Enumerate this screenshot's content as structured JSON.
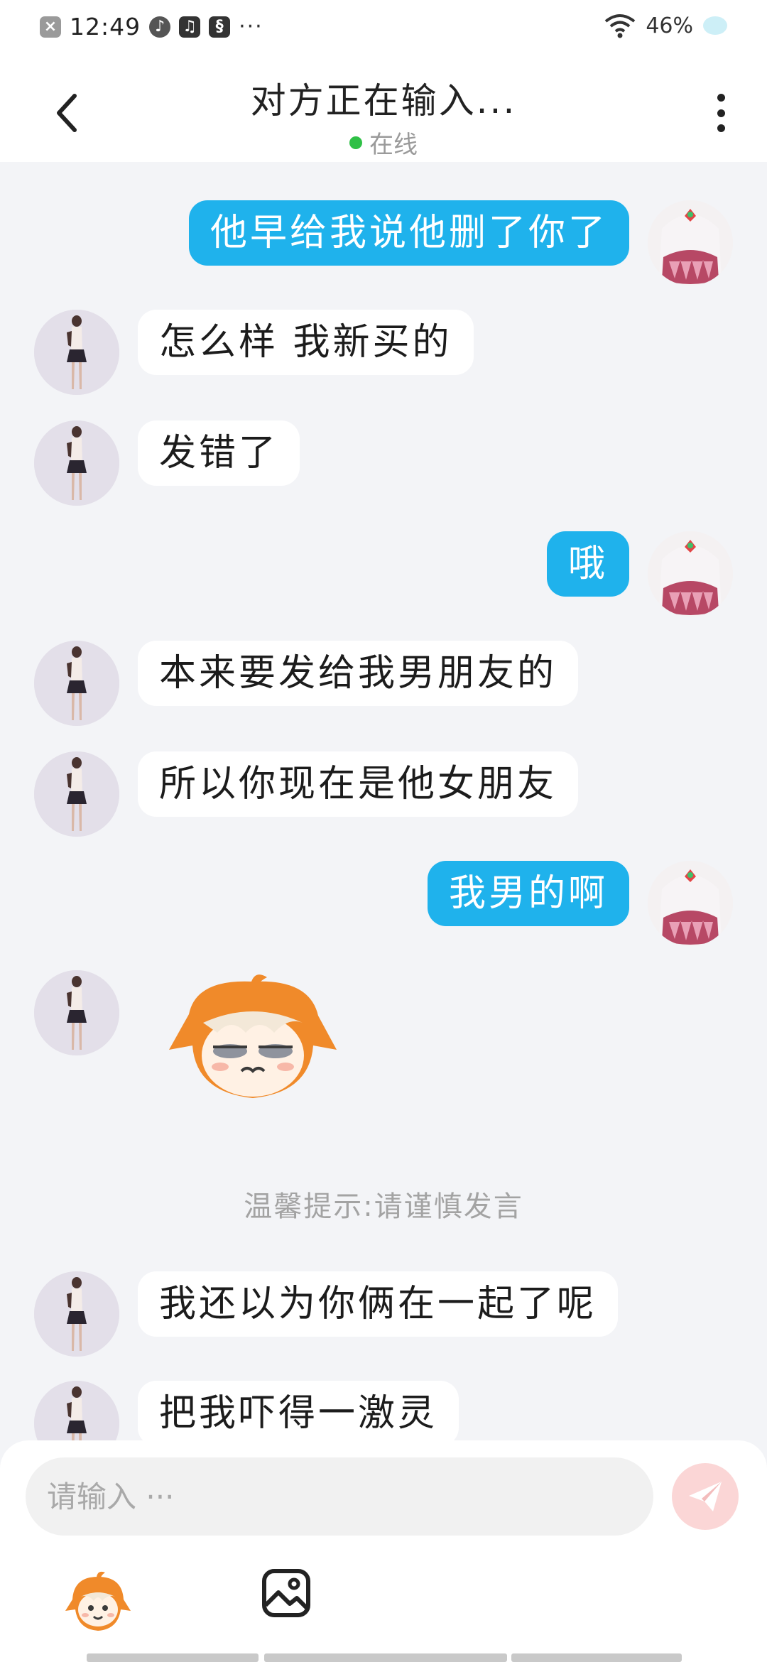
{
  "status_bar": {
    "time": "12:49",
    "more": "···",
    "battery": "46%"
  },
  "header": {
    "title": "对方正在输入...",
    "status": "在线"
  },
  "messages": [
    {
      "side": "out",
      "text": "他早给我说他删了你了"
    },
    {
      "side": "in",
      "text": "怎么样 我新买的"
    },
    {
      "side": "in",
      "text": "发错了"
    },
    {
      "side": "out",
      "text": "哦"
    },
    {
      "side": "in",
      "text": "本来要发给我男朋友的"
    },
    {
      "side": "in",
      "text": "所以你现在是他女朋友"
    },
    {
      "side": "out",
      "text": "我男的啊"
    },
    {
      "side": "in",
      "type": "sticker",
      "sticker": "orange-haired-chibi-sticker"
    },
    {
      "side": "in",
      "text": "我还以为你俩在一起了呢"
    },
    {
      "side": "in",
      "text": "把我吓得一激灵"
    }
  ],
  "tip": "温馨提示:请谨慎发言",
  "composer": {
    "placeholder": "请输入 ···"
  },
  "colors": {
    "outgoing_bubble": "#1fb2ec",
    "incoming_bubble": "#ffffff",
    "background": "#f3f4f7",
    "online": "#2fc046",
    "send_disabled": "#fbd6d6"
  }
}
